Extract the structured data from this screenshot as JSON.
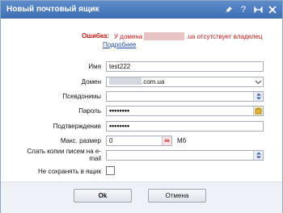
{
  "window": {
    "title": "Новый почтовый ящик",
    "controls": [
      "pin-icon",
      "help-icon",
      "maximize-icon",
      "close-icon"
    ]
  },
  "error": {
    "label": "Ошибка:",
    "prefix": "У домена",
    "suffix": ".ua отсутствует владелец",
    "link": "Подробнее"
  },
  "form": {
    "name": {
      "label": "Имя",
      "value": "test222"
    },
    "domain": {
      "label": "Домен",
      "value_suffix": ".com.ua"
    },
    "aliases": {
      "label": "Псевдонимы",
      "value": ""
    },
    "password": {
      "label": "Пароль",
      "value": "••••••••"
    },
    "confirm": {
      "label": "Подтверждение",
      "value": "••••••••"
    },
    "max_size": {
      "label": "Макс. размер",
      "value": "0",
      "unit": "Мб"
    },
    "copy_to": {
      "label": "Слать копии писем на e-mail",
      "value": ""
    },
    "no_store": {
      "label": "Не сохранять в ящик",
      "checked": false
    }
  },
  "buttons": {
    "ok": "Ok",
    "cancel": "Отмена"
  },
  "colors": {
    "titlebar": "#4f7fc0",
    "error": "#c81515",
    "link": "#1f4fa8"
  }
}
